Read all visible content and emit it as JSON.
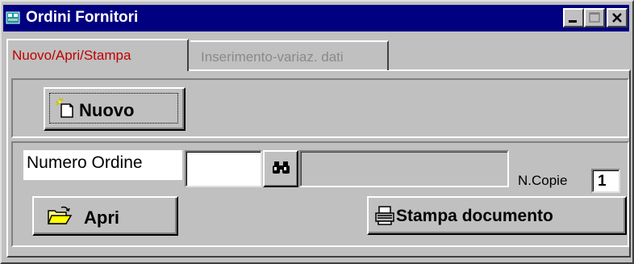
{
  "window": {
    "title": "Ordini Fornitori",
    "title_icon": "database-window-icon",
    "caption_buttons": [
      "minimize",
      "maximize",
      "close"
    ]
  },
  "tabs": [
    {
      "label": "Nuovo/Apri/Stampa",
      "active": true
    },
    {
      "label": "Inserimento-variaz. dati",
      "active": false
    }
  ],
  "form": {
    "nuovo_button": "Nuovo",
    "numero_ordine_label": "Numero Ordine",
    "numero_ordine_value": "",
    "find_icon": "binoculars-icon",
    "descrizione_value": "",
    "copie_label": "N.Copie",
    "copie_value": "1",
    "apri_button": "Apri",
    "stampa_button": "Stampa documento"
  },
  "colors": {
    "titlebar": "#000080",
    "face": "#c0c0c0",
    "active_tab_text": "#c00000",
    "inactive_tab_text": "#8a8a8a"
  }
}
